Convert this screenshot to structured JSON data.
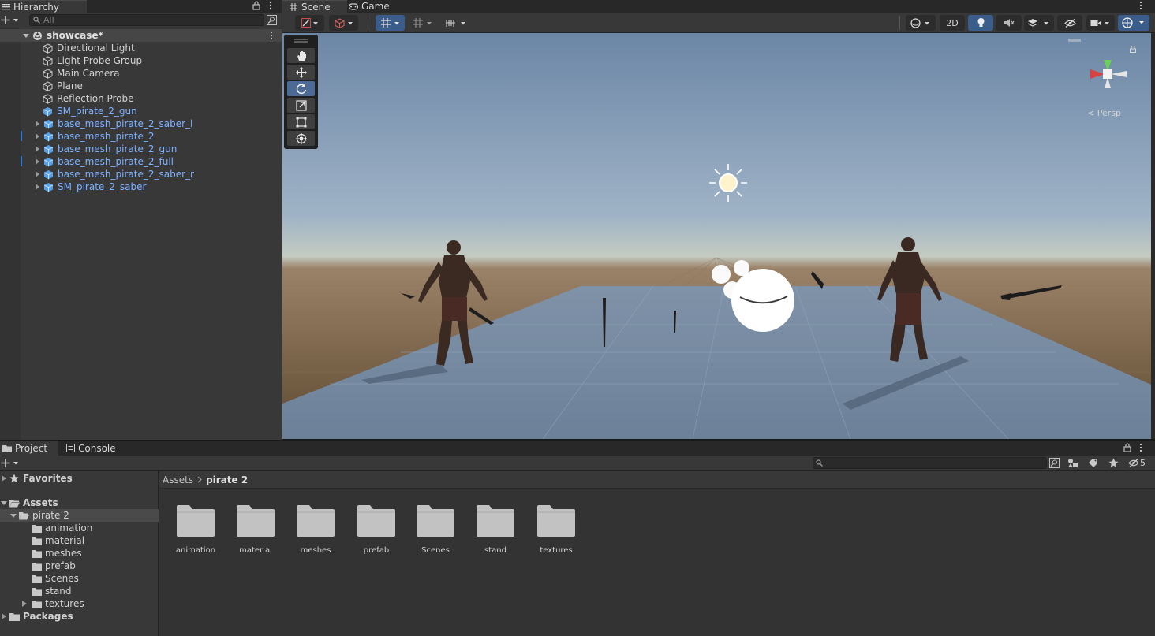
{
  "hierarchy": {
    "tab_label": "Hierarchy",
    "search_placeholder": "All",
    "scene_name": "showcase*",
    "items": [
      {
        "label": "Directional Light",
        "prefab": false,
        "expandable": false
      },
      {
        "label": "Light Probe Group",
        "prefab": false,
        "expandable": false
      },
      {
        "label": "Main Camera",
        "prefab": false,
        "expandable": false
      },
      {
        "label": "Plane",
        "prefab": false,
        "expandable": false
      },
      {
        "label": "Reflection Probe",
        "prefab": false,
        "expandable": false
      },
      {
        "label": "SM_pirate_2_gun",
        "prefab": true,
        "expandable": false
      },
      {
        "label": "base_mesh_pirate_2_saber_l",
        "prefab": true,
        "expandable": true
      },
      {
        "label": "base_mesh_pirate_2",
        "prefab": true,
        "expandable": true
      },
      {
        "label": "base_mesh_pirate_2_gun",
        "prefab": true,
        "expandable": true
      },
      {
        "label": "base_mesh_pirate_2_full",
        "prefab": true,
        "expandable": true
      },
      {
        "label": "base_mesh_pirate_2_saber_r",
        "prefab": true,
        "expandable": true
      },
      {
        "label": "SM_pirate_2_saber",
        "prefab": true,
        "expandable": true
      }
    ]
  },
  "scene": {
    "tabs": [
      "Scene",
      "Game"
    ],
    "mode_2d_label": "2D",
    "camera_mode": "< Persp"
  },
  "project": {
    "tabs": [
      "Project",
      "Console"
    ],
    "hidden_count": "5",
    "breadcrumb": [
      "Assets",
      "pirate 2"
    ],
    "tree": {
      "favorites": "Favorites",
      "assets": "Assets",
      "selected_folder": "pirate 2",
      "subfolders": [
        "animation",
        "material",
        "meshes",
        "prefab",
        "Scenes",
        "stand",
        "textures"
      ],
      "packages": "Packages"
    },
    "assets": [
      "animation",
      "material",
      "meshes",
      "prefab",
      "Scenes",
      "stand",
      "textures"
    ]
  },
  "colors": {
    "prefab_text": "#7cb1ff",
    "selection_blue": "#3a5d8c",
    "panel_bg": "#383838"
  }
}
